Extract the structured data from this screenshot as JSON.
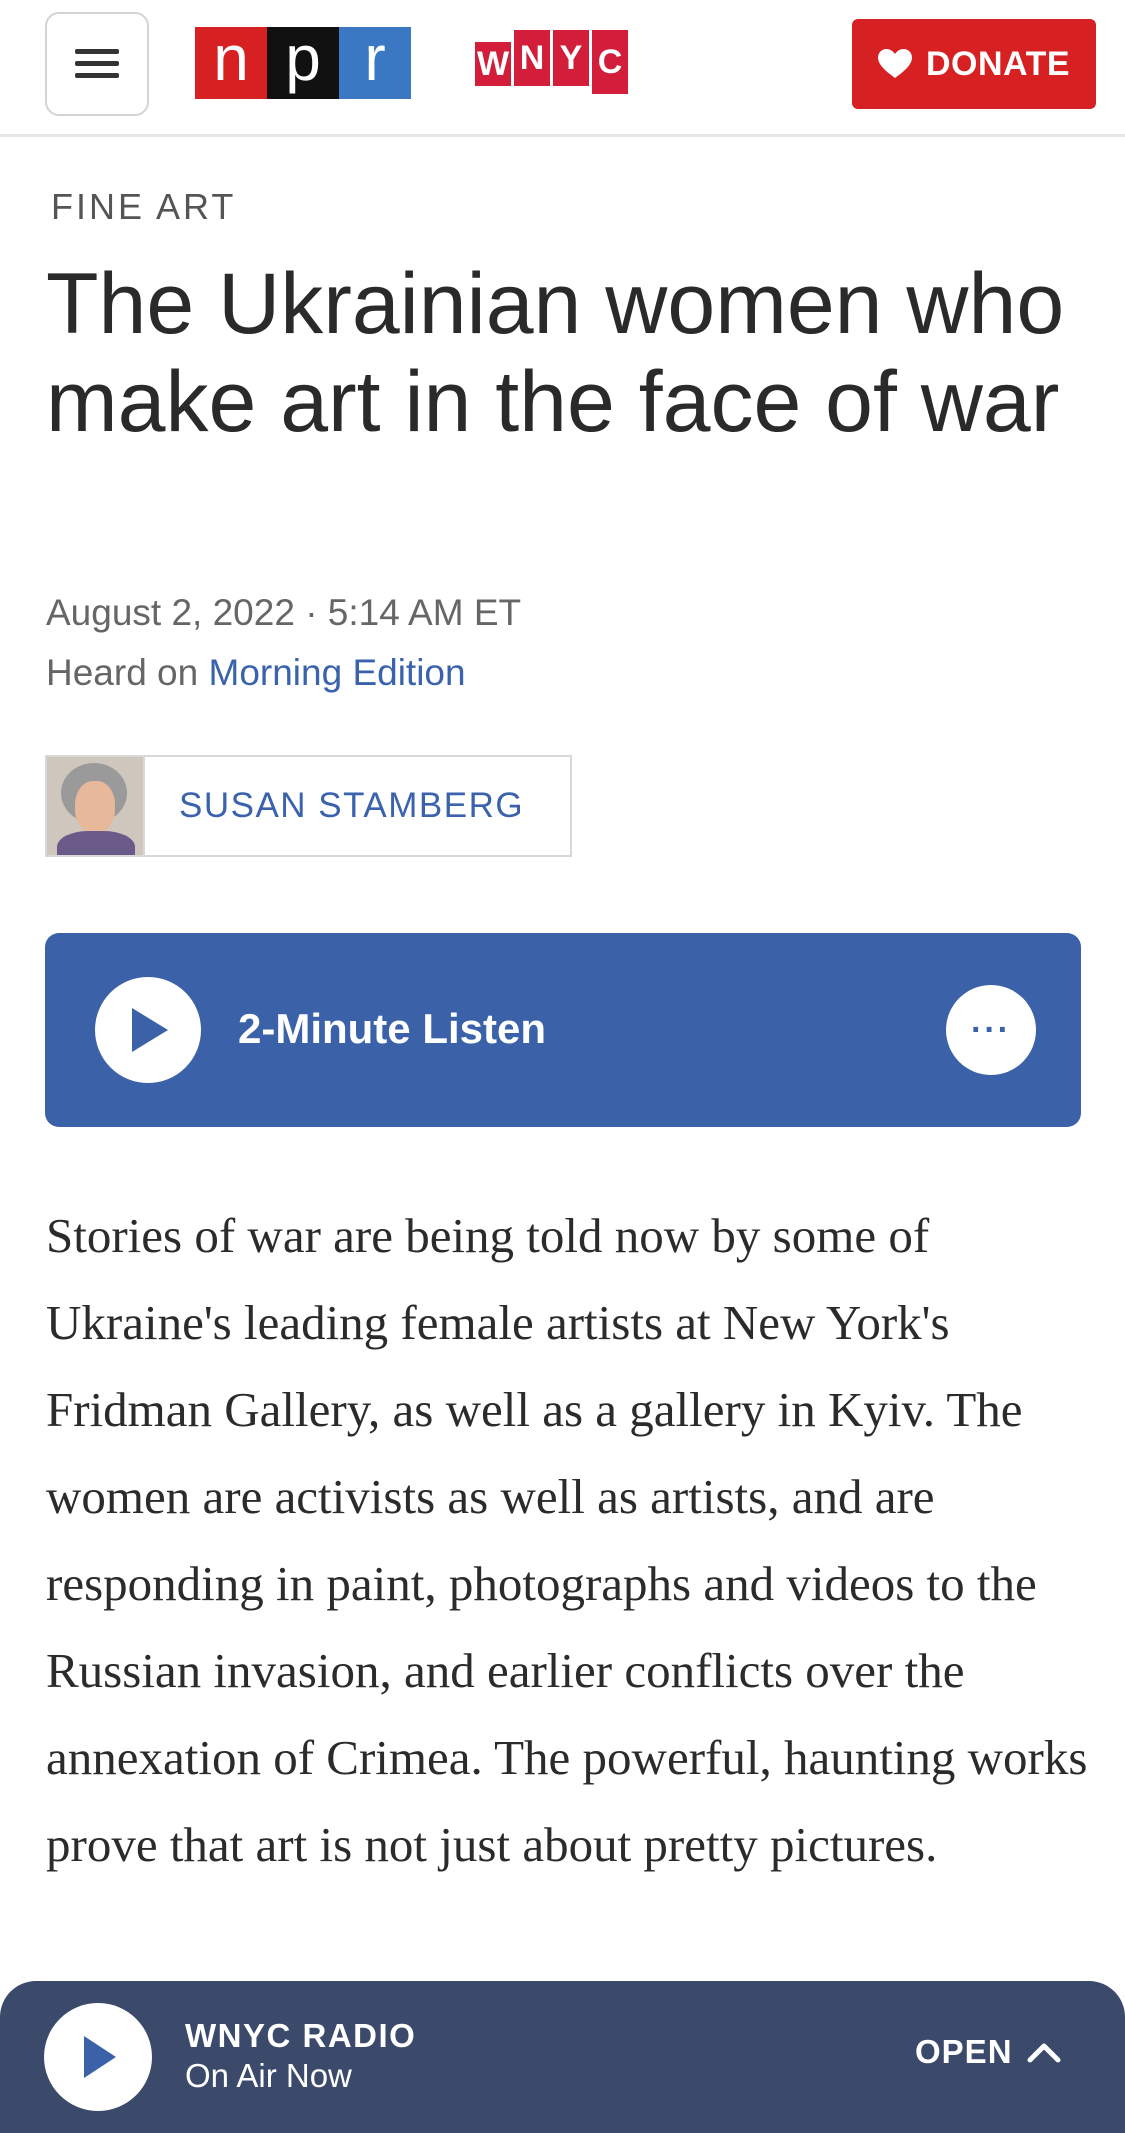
{
  "header": {
    "menu_icon": "hamburger-menu-icon",
    "npr_logo": [
      "n",
      "p",
      "r"
    ],
    "wnyc_logo": [
      "W",
      "N",
      "Y",
      "C"
    ],
    "donate_label": "DONATE",
    "donate_icon": "heart-icon",
    "colors": {
      "npr_red": "#d62021",
      "npr_black": "#111111",
      "npr_blue": "#3a78c4",
      "wnyc_red": "#d21e3b"
    }
  },
  "article": {
    "slug": "FINE ART",
    "title": "The Ukrainian women who make art in the face of war",
    "dateline": "August 2, 2022 · 5:14 AM ET",
    "heard_prefix": "Heard on",
    "show": "Morning Edition",
    "author": "SUSAN STAMBERG",
    "body": "Stories of war are being told now by some of Ukraine's leading female artists at New York's Fridman Gallery, as well as a gallery in Kyiv. The women are activists as well as artists, and are responding in paint, photographs and videos to the Russian invasion, and earlier conflicts over the annexation of Crimea. The powerful, haunting works prove that art is not just about pretty pictures."
  },
  "player": {
    "label": "2-Minute Listen",
    "play_icon": "play-icon",
    "more_label": "···",
    "color": "#3b62a9"
  },
  "radio_bar": {
    "station": "WNYC RADIO",
    "status": "On Air Now",
    "open_label": "OPEN",
    "open_icon": "chevron-up-icon",
    "color": "#3b4a6b"
  }
}
